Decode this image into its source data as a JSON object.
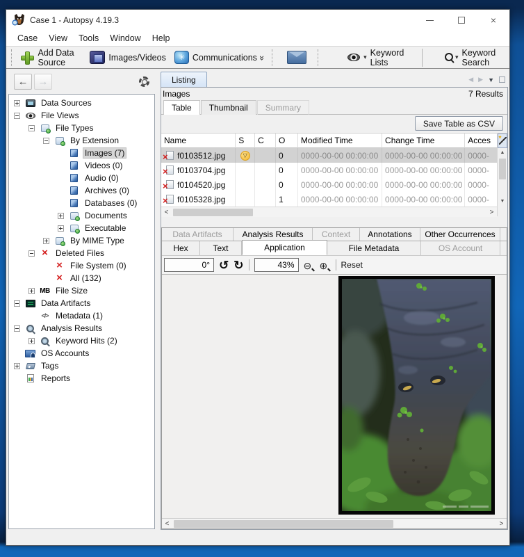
{
  "window": {
    "title": "Case 1 - Autopsy 4.19.3",
    "app_icon": "autopsy-dog-icon"
  },
  "menu": {
    "items": [
      "Case",
      "View",
      "Tools",
      "Window",
      "Help"
    ]
  },
  "toolbar": {
    "add_data_source": "Add Data Source",
    "images_videos": "Images/Videos",
    "communications": "Communications",
    "keyword_lists": "Keyword Lists",
    "keyword_search": "Keyword Search",
    "icons": [
      "add-plus-icon",
      "images-videos-icon",
      "communications-globe-icon",
      "email-icon",
      "eye-icon",
      "search-icon"
    ]
  },
  "sidebar": {
    "items": [
      {
        "label": "Data Sources",
        "icon": "data-sources-icon"
      },
      {
        "label": "File Views",
        "icon": "eye-icon"
      },
      {
        "label": "File Types",
        "icon": "file-types-icon"
      },
      {
        "label": "By Extension",
        "icon": "file-types-icon"
      },
      {
        "label": "Images (7)",
        "icon": "file-category-icon",
        "selected": true
      },
      {
        "label": "Videos (0)",
        "icon": "file-category-icon"
      },
      {
        "label": "Audio (0)",
        "icon": "file-category-icon"
      },
      {
        "label": "Archives (0)",
        "icon": "file-category-icon"
      },
      {
        "label": "Databases (0)",
        "icon": "file-category-icon"
      },
      {
        "label": "Documents",
        "icon": "file-types-icon"
      },
      {
        "label": "Executable",
        "icon": "file-types-icon"
      },
      {
        "label": "By MIME Type",
        "icon": "file-types-icon"
      },
      {
        "label": "Deleted Files",
        "icon": "deleted-x-icon"
      },
      {
        "label": "File System (0)",
        "icon": "deleted-x-icon"
      },
      {
        "label": "All (132)",
        "icon": "deleted-x-icon"
      },
      {
        "label": "File Size",
        "icon": "mb-badge-icon",
        "icon_text": "MB"
      },
      {
        "label": "Data Artifacts",
        "icon": "data-artifacts-icon"
      },
      {
        "label": "Metadata (1)",
        "icon": "code-icon",
        "icon_text": "</>"
      },
      {
        "label": "Analysis Results",
        "icon": "magnifier-icon"
      },
      {
        "label": "Keyword Hits (2)",
        "icon": "magnifier-icon"
      },
      {
        "label": "OS Accounts",
        "icon": "os-accounts-icon"
      },
      {
        "label": "Tags",
        "icon": "tag-icon"
      },
      {
        "label": "Reports",
        "icon": "report-icon"
      }
    ]
  },
  "listing": {
    "tab": "Listing",
    "title": "Images",
    "results": "7 Results",
    "view_tabs": {
      "table": "Table",
      "thumbnail": "Thumbnail",
      "summary": "Summary"
    },
    "save_csv": "Save Table as CSV"
  },
  "table": {
    "columns": {
      "name": "Name",
      "s": "S",
      "c": "C",
      "o": "O",
      "modified": "Modified Time",
      "changed": "Change Time",
      "accessed": "Acces"
    },
    "corner_icon": "column-wand-icon",
    "rows": [
      {
        "name": "f0103512.jpg",
        "s_icon": "score-icon",
        "o": "0",
        "modified": "0000-00-00 00:00:00",
        "changed": "0000-00-00 00:00:00",
        "accessed": "0000-",
        "selected": true
      },
      {
        "name": "f0103704.jpg",
        "s_icon": "",
        "o": "0",
        "modified": "0000-00-00 00:00:00",
        "changed": "0000-00-00 00:00:00",
        "accessed": "0000-"
      },
      {
        "name": "f0104520.jpg",
        "s_icon": "",
        "o": "0",
        "modified": "0000-00-00 00:00:00",
        "changed": "0000-00-00 00:00:00",
        "accessed": "0000-"
      },
      {
        "name": "f0105328.jpg",
        "s_icon": "",
        "o": "1",
        "modified": "0000-00-00 00:00:00",
        "changed": "0000-00-00 00:00:00",
        "accessed": "0000-"
      }
    ]
  },
  "details": {
    "row1": [
      "Data Artifacts",
      "Analysis Results",
      "Context",
      "Annotations",
      "Other Occurrences"
    ],
    "row2": [
      "Hex",
      "Text",
      "Application",
      "File Metadata",
      "OS Account"
    ]
  },
  "media": {
    "rotation": "0°",
    "zoom": "43%",
    "reset": "Reset"
  },
  "colors": {
    "selection_grey": "#d6d6d6",
    "listing_tab_blue": "#d8e6f6",
    "score_yellow": "#f2b62c",
    "deleted_red": "#d41f1f",
    "desktop_blue": "#1166b8"
  }
}
